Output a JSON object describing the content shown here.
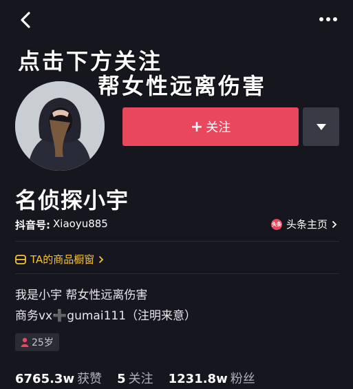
{
  "banner": {
    "line1": "点击下方关注",
    "line2": "帮女性远离伤害"
  },
  "profile": {
    "name": "名侦探小宇",
    "account_label": "抖音号:",
    "account_id": "Xiaoyu885",
    "toutiao_badge": "头条",
    "toutiao_link": "头条主页"
  },
  "actions": {
    "follow_plus": "+",
    "follow_label": "关注"
  },
  "shop_window": {
    "label": "TA的商品橱窗"
  },
  "bio": {
    "line1": "我是小宇 帮女性远离伤害",
    "line2_prefix": "商务vx",
    "line2_plus": "➕",
    "line2_suffix": "gumai111（注明来意）"
  },
  "age_tag": {
    "text": "25岁"
  },
  "stats": {
    "likes_value": "6765.3w",
    "likes_label": "获赞",
    "following_value": "5",
    "following_label": "关注",
    "followers_value": "1231.8w",
    "followers_label": "粉丝"
  },
  "colors": {
    "background": "#16161e",
    "follow_button": "#e9475d",
    "shop_accent": "#f5c23b"
  }
}
